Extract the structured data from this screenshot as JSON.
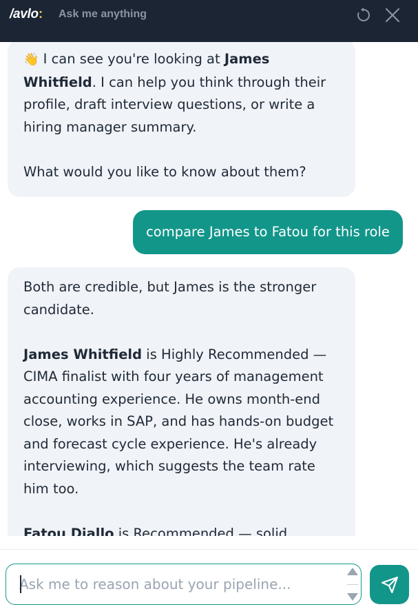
{
  "header": {
    "logo_text": "avlo",
    "logo_slash": "/",
    "logo_colon": ":",
    "title": "Ask me anything",
    "reset_icon": "reset-icon",
    "close_icon": "close-icon"
  },
  "messages": [
    {
      "role": "assistant",
      "emoji": "👋",
      "p1_before": " I can see you're looking at ",
      "p1_bold": "James Whitfield",
      "p1_after": ". I can help you think through their profile, draft interview questions, or write a hiring manager summary.",
      "p2": "What would you like to know about them?"
    },
    {
      "role": "user",
      "text": "compare James to Fatou for this role"
    },
    {
      "role": "assistant",
      "p1": "Both are credible, but James is the stronger candidate.",
      "p2_bold": "James Whitfield",
      "p2_after": " is Highly Recommended — CIMA finalist with four years of management accounting experience. He owns month-end close, works in SAP, and has hands-on budget and forecast cycle experience. He's already interviewing, which suggests the team rate him too.",
      "p3_bold": "Fatou Diallo",
      "p3_after": " is Recommended — solid"
    }
  ],
  "composer": {
    "placeholder": "Ask me to reason about your pipeline...",
    "value": "",
    "send_icon": "send-icon"
  },
  "colors": {
    "header_bg": "#1b2534",
    "accent": "#13968a",
    "assistant_bubble": "#f0f3f7",
    "logo_colon": "#f2c94c"
  }
}
